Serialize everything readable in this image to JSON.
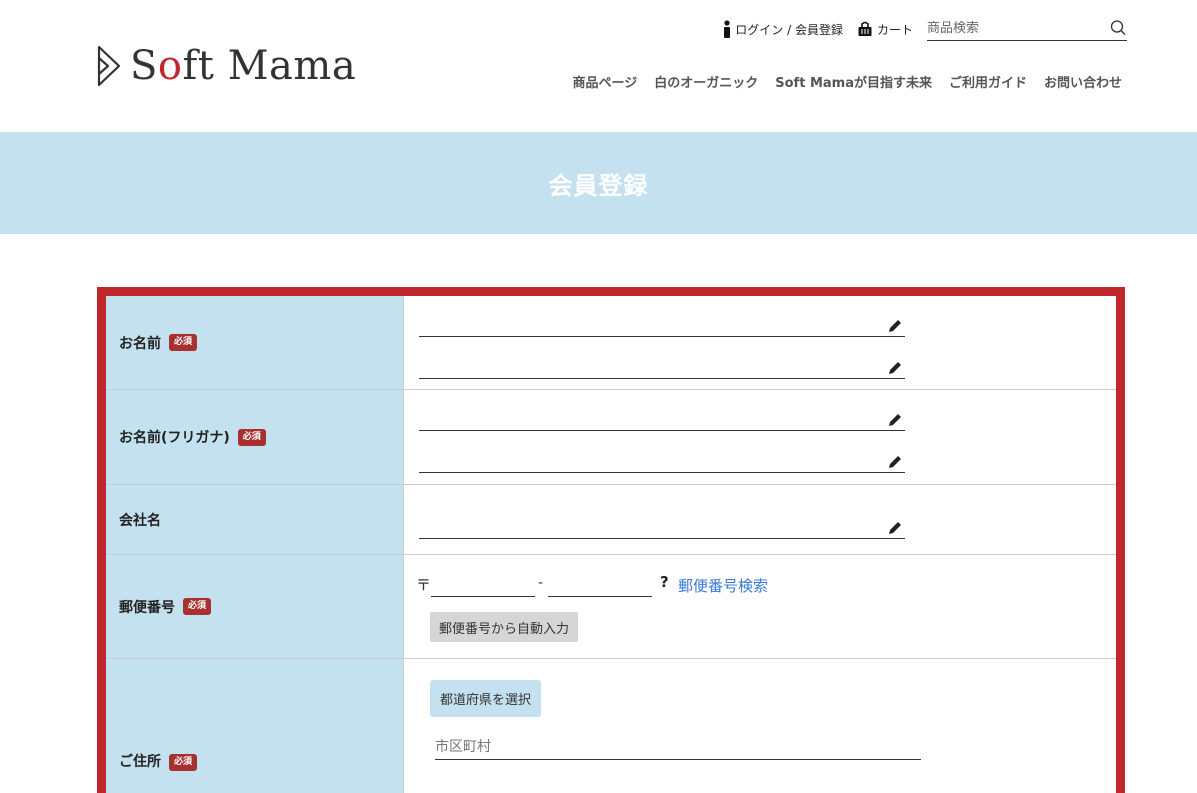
{
  "header": {
    "logo_text_s": "S",
    "logo_text_o": "o",
    "logo_text_rest": "ft Mama",
    "login_label": "ログイン / 会員登録",
    "cart_label": "カート",
    "search_placeholder": "商品検索",
    "nav": [
      "商品ページ",
      "白のオーガニック",
      "Soft Mamaが目指す未来",
      "ご利用ガイド",
      "お問い合わせ"
    ]
  },
  "banner": {
    "title": "会員登録"
  },
  "form": {
    "required_badge": "必須",
    "name_label": "お名前",
    "kana_label": "お名前(フリガナ)",
    "company_label": "会社名",
    "zip_label": "郵便番号",
    "zip_mark": "〒",
    "zip_dash": "-",
    "zip_help": "?",
    "zip_search_link": "郵便番号検索",
    "zip_auto_button": "郵便番号から自動入力",
    "address_label": "ご住所",
    "prefecture_button": "都道府県を選択",
    "city_placeholder": "市区町村"
  },
  "colors": {
    "accent_red": "#c0262b",
    "label_bg": "#c3e1ee",
    "link_blue": "#3a7ad5"
  },
  "icons": [
    "logo-mark-icon",
    "person-icon",
    "cart-icon",
    "search-icon",
    "pencil-icon",
    "question-icon"
  ]
}
